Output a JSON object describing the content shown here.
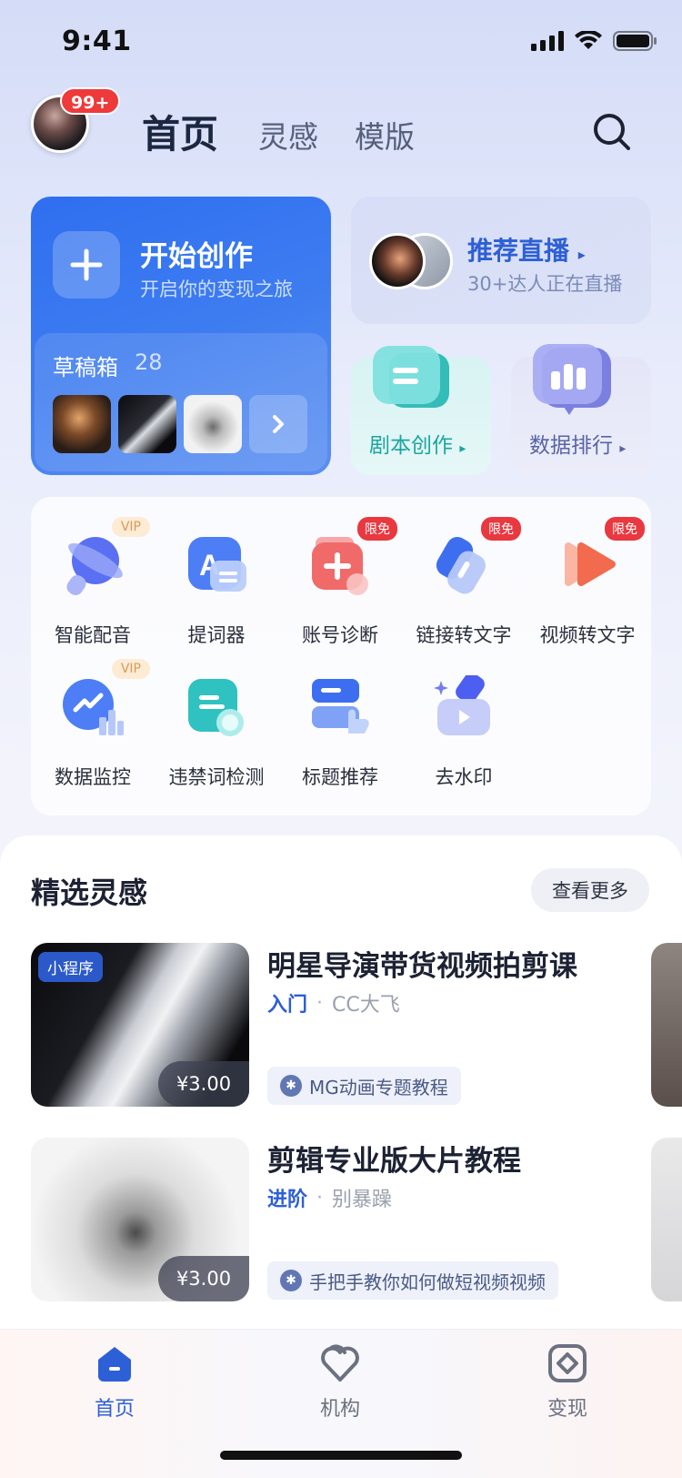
{
  "status_bar": {
    "time": "9:41"
  },
  "header": {
    "avatar_badge": "99+",
    "tabs": [
      {
        "label": "首页",
        "active": true
      },
      {
        "label": "灵感",
        "active": false
      },
      {
        "label": "模版",
        "active": false
      }
    ]
  },
  "start_card": {
    "title": "开始创作",
    "subtitle": "开启你的变现之旅",
    "draft_label": "草稿箱",
    "draft_count": "28"
  },
  "live_card": {
    "title": "推荐直播",
    "subtitle": "30+达人正在直播"
  },
  "mini_cards": [
    {
      "label": "剧本创作",
      "color": "#1aa6a0"
    },
    {
      "label": "数据排行",
      "color": "#5964a6"
    }
  ],
  "tools": [
    {
      "label": "智能配音",
      "badge": "VIP",
      "icon": "voice-icon"
    },
    {
      "label": "提词器",
      "badge": "",
      "icon": "prompter-icon"
    },
    {
      "label": "账号诊断",
      "badge": "限免",
      "icon": "diagnosis-icon"
    },
    {
      "label": "链接转文字",
      "badge": "限免",
      "icon": "link-icon"
    },
    {
      "label": "视频转文字",
      "badge": "限免",
      "icon": "video-text-icon"
    },
    {
      "label": "数据监控",
      "badge": "VIP",
      "icon": "monitor-icon"
    },
    {
      "label": "违禁词检测",
      "badge": "",
      "icon": "forbidden-word-icon"
    },
    {
      "label": "标题推荐",
      "badge": "",
      "icon": "title-icon"
    },
    {
      "label": "去水印",
      "badge": "",
      "icon": "watermark-icon"
    }
  ],
  "featured": {
    "title": "精选灵感",
    "more": "查看更多",
    "courses": [
      {
        "title": "明星导演带货视频拍剪课",
        "level": "入门",
        "author": "CC大飞",
        "price": "¥3.00",
        "tag": "小程序",
        "chip": "MG动画专题教程"
      },
      {
        "title": "剪辑专业版大片教程",
        "level": "进阶",
        "author": "别暴躁",
        "price": "¥3.00",
        "tag": "",
        "chip": "手把手教你如何做短视频视频"
      }
    ]
  },
  "bottom_nav": [
    {
      "label": "首页",
      "active": true
    },
    {
      "label": "机构",
      "active": false
    },
    {
      "label": "变现",
      "active": false
    }
  ],
  "colors": {
    "primary": "#2d5fd6",
    "accent_red": "#ee3a3a",
    "teal": "#1aa6a0"
  }
}
